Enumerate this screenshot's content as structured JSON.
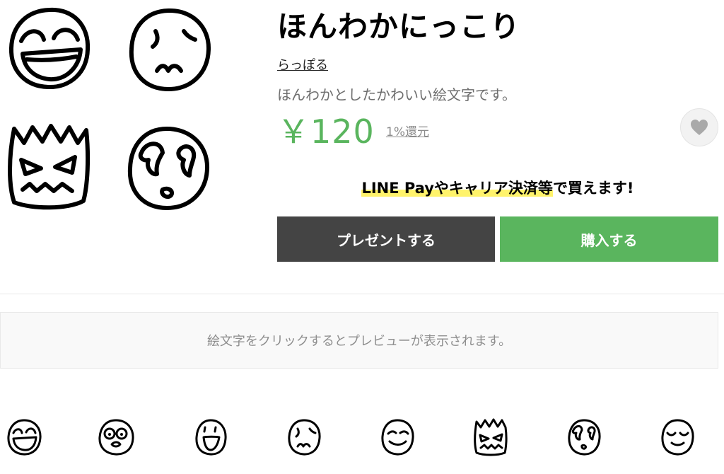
{
  "product": {
    "title": "ほんわかにっこり",
    "author": "らっぽる",
    "description": "ほんわかとしたかわいい絵文字です。",
    "price": "￥120",
    "cashback": "1%還元",
    "payment_note_highlight": "LINE Payやキャリア決済等",
    "payment_note_rest": "で買えます!"
  },
  "actions": {
    "present_label": "プレゼントする",
    "buy_label": "購入する",
    "favorite_icon": "heart-icon"
  },
  "preview": {
    "hint": "絵文字をクリックするとプレビューが表示されます。"
  },
  "hero_emojis": [
    "laughing-face-icon",
    "worried-face-icon",
    "angry-face-icon",
    "crying-face-icon"
  ],
  "emoji_grid": [
    "laughing-face-icon",
    "glasses-face-icon",
    "open-mouth-face-icon",
    "worried-face-icon",
    "smiling-face-icon",
    "angry-face-icon",
    "crying-face-icon",
    "content-face-icon"
  ],
  "colors": {
    "accent_green": "#5ab55e",
    "present_button": "#444444",
    "highlight_yellow": "#fff36b",
    "price": "#5ab55e"
  }
}
